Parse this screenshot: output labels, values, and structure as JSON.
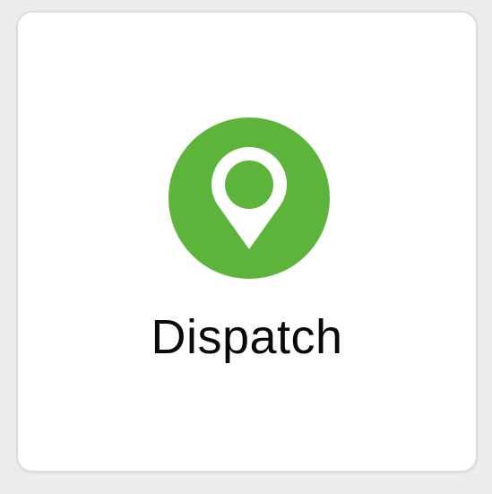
{
  "tile": {
    "label": "Dispatch",
    "icon": "map-pin-icon",
    "accent_color": "#5cb53a",
    "icon_fg_color": "#ffffff"
  }
}
